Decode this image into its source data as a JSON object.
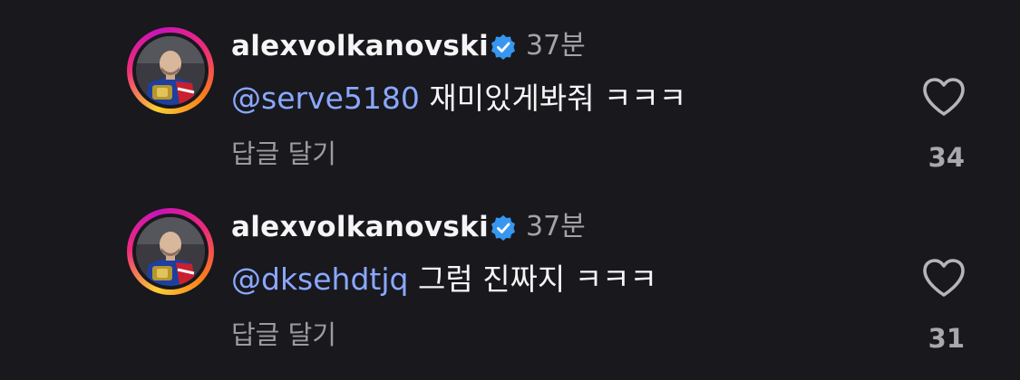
{
  "comments": [
    {
      "username": "alexvolkanovski",
      "time": "37분",
      "mention": "@serve5180",
      "text": "재미있게봐줘 ㅋㅋㅋ",
      "reply_label": "답글 달기",
      "like_count": "34",
      "avatar_icon": "profile-photo",
      "verified_icon": "verified-badge-icon",
      "like_icon": "heart-outline-icon"
    },
    {
      "username": "alexvolkanovski",
      "time": "37분",
      "mention": "@dksehdtjq",
      "text": "그럼 진짜지 ㅋㅋㅋ",
      "reply_label": "답글 달기",
      "like_count": "31",
      "avatar_icon": "profile-photo",
      "verified_icon": "verified-badge-icon",
      "like_icon": "heart-outline-icon"
    }
  ],
  "colors": {
    "background": "#18181d",
    "mention": "#8aa8ff",
    "verified": "#3797f0",
    "secondary_text": "#a3a3a8"
  }
}
